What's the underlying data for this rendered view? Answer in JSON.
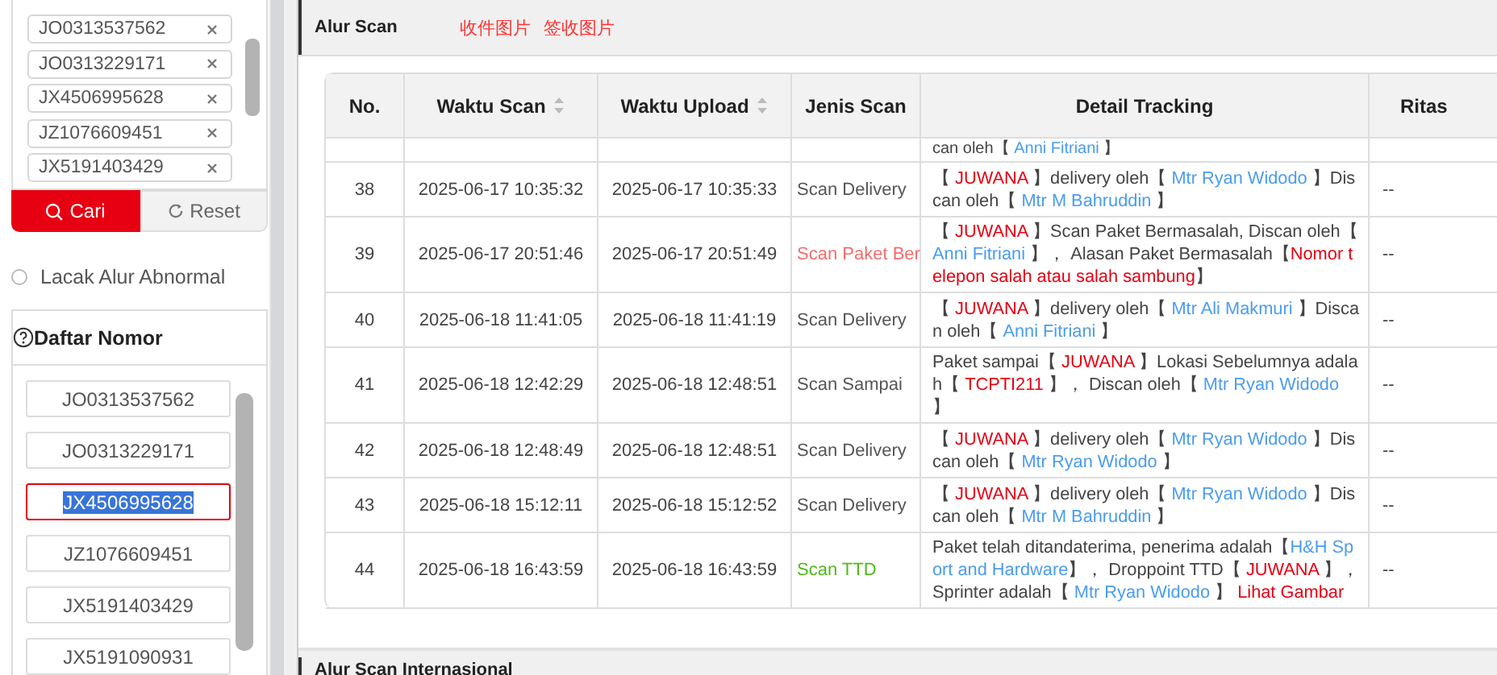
{
  "sidebar": {
    "tags": [
      {
        "label": "JO0313537562"
      },
      {
        "label": "JO0313229171"
      },
      {
        "label": "JX4506995628"
      },
      {
        "label": "JZ1076609451"
      },
      {
        "label": "JX5191403429"
      }
    ],
    "search_button": "Cari",
    "reset_button": "Reset",
    "abnormal_option": {
      "label": "Lacak Alur Abnormal",
      "checked": false
    },
    "number_list": {
      "title": "Daftar Nomor",
      "items": [
        {
          "label": "JO0313537562",
          "selected": false
        },
        {
          "label": "JO0313229171",
          "selected": false
        },
        {
          "label": "JX4506995628",
          "selected": true
        },
        {
          "label": "JZ1076609451",
          "selected": false
        },
        {
          "label": "JX5191403429",
          "selected": false
        },
        {
          "label": "JX5191090931",
          "selected": false
        }
      ]
    }
  },
  "section": {
    "title": "Alur Scan",
    "links": [
      "收件图片",
      "签收图片"
    ]
  },
  "table": {
    "columns": [
      {
        "label": "No.",
        "sortable": false
      },
      {
        "label": "Waktu Scan",
        "sortable": true
      },
      {
        "label": "Waktu Upload",
        "sortable": true
      },
      {
        "label": "Jenis Scan",
        "sortable": false
      },
      {
        "label": "Detail Tracking",
        "sortable": false
      },
      {
        "label": "Ritas",
        "sortable": false
      }
    ],
    "rows": [
      {
        "detail": [
          {
            "text": "can oleh【 ",
            "kind": "plain"
          },
          {
            "text": "Anni Fitriani",
            "kind": "person"
          },
          {
            "text": " 】",
            "kind": "plain"
          }
        ]
      },
      {
        "no": "38",
        "scan_time": "2025-06-17 10:35:32",
        "upload_time": "2025-06-17 10:35:33",
        "scan_type": {
          "text": "Scan Delivery",
          "kind": "normal"
        },
        "detail": [
          {
            "text": "【 ",
            "kind": "plain"
          },
          {
            "text": "JUWANA",
            "kind": "place"
          },
          {
            "text": " 】delivery oleh【 ",
            "kind": "plain"
          },
          {
            "text": "Mtr Ryan Widodo",
            "kind": "person"
          },
          {
            "text": " 】Discan oleh【 ",
            "kind": "plain"
          },
          {
            "text": "Mtr M Bahruddin",
            "kind": "person"
          },
          {
            "text": " 】",
            "kind": "plain"
          }
        ],
        "ritase": "--"
      },
      {
        "no": "39",
        "scan_time": "2025-06-17 20:51:46",
        "upload_time": "2025-06-17 20:51:49",
        "scan_type": {
          "text": "Scan Paket Ber",
          "kind": "problem"
        },
        "detail": [
          {
            "text": "【 ",
            "kind": "plain"
          },
          {
            "text": "JUWANA",
            "kind": "place"
          },
          {
            "text": " 】Scan Paket Bermasalah, Discan oleh【 ",
            "kind": "plain"
          },
          {
            "text": "Anni Fitriani",
            "kind": "person"
          },
          {
            "text": " 】， Alasan Paket Bermasalah【",
            "kind": "plain"
          },
          {
            "text": "Nomor telepon salah atau salah sambung",
            "kind": "alert"
          },
          {
            "text": "】",
            "kind": "plain"
          }
        ],
        "ritase": "--"
      },
      {
        "no": "40",
        "scan_time": "2025-06-18 11:41:05",
        "upload_time": "2025-06-18 11:41:19",
        "scan_type": {
          "text": "Scan Delivery",
          "kind": "normal"
        },
        "detail": [
          {
            "text": "【 ",
            "kind": "plain"
          },
          {
            "text": "JUWANA",
            "kind": "place"
          },
          {
            "text": " 】delivery oleh【 ",
            "kind": "plain"
          },
          {
            "text": "Mtr Ali Makmuri",
            "kind": "person"
          },
          {
            "text": " 】Discan oleh【 ",
            "kind": "plain"
          },
          {
            "text": "Anni Fitriani",
            "kind": "person"
          },
          {
            "text": " 】",
            "kind": "plain"
          }
        ],
        "ritase": "--"
      },
      {
        "no": "41",
        "scan_time": "2025-06-18 12:42:29",
        "upload_time": "2025-06-18 12:48:51",
        "scan_type": {
          "text": "Scan Sampai",
          "kind": "normal"
        },
        "detail": [
          {
            "text": "Paket sampai【 ",
            "kind": "plain"
          },
          {
            "text": "JUWANA",
            "kind": "place"
          },
          {
            "text": " 】Lokasi Sebelumnya adalah【 ",
            "kind": "plain"
          },
          {
            "text": "TCPTI211",
            "kind": "place"
          },
          {
            "text": " 】， Discan oleh【 ",
            "kind": "plain"
          },
          {
            "text": "Mtr Ryan Widodo",
            "kind": "person"
          },
          {
            "text": " 】",
            "kind": "plain"
          }
        ],
        "ritase": "--"
      },
      {
        "no": "42",
        "scan_time": "2025-06-18 12:48:49",
        "upload_time": "2025-06-18 12:48:51",
        "scan_type": {
          "text": "Scan Delivery",
          "kind": "normal"
        },
        "detail": [
          {
            "text": "【 ",
            "kind": "plain"
          },
          {
            "text": "JUWANA",
            "kind": "place"
          },
          {
            "text": " 】delivery oleh【 ",
            "kind": "plain"
          },
          {
            "text": "Mtr Ryan Widodo",
            "kind": "person"
          },
          {
            "text": " 】Discan oleh【 ",
            "kind": "plain"
          },
          {
            "text": "Mtr Ryan Widodo",
            "kind": "person"
          },
          {
            "text": " 】",
            "kind": "plain"
          }
        ],
        "ritase": "--"
      },
      {
        "no": "43",
        "scan_time": "2025-06-18 15:12:11",
        "upload_time": "2025-06-18 15:12:52",
        "scan_type": {
          "text": "Scan Delivery",
          "kind": "normal"
        },
        "detail": [
          {
            "text": "【 ",
            "kind": "plain"
          },
          {
            "text": "JUWANA",
            "kind": "place"
          },
          {
            "text": " 】delivery oleh【 ",
            "kind": "plain"
          },
          {
            "text": "Mtr Ryan Widodo",
            "kind": "person"
          },
          {
            "text": " 】Discan oleh【 ",
            "kind": "plain"
          },
          {
            "text": "Mtr M Bahruddin",
            "kind": "person"
          },
          {
            "text": " 】",
            "kind": "plain"
          }
        ],
        "ritase": "--"
      },
      {
        "no": "44",
        "scan_time": "2025-06-18 16:43:59",
        "upload_time": "2025-06-18 16:43:59",
        "scan_type": {
          "text": "Scan TTD",
          "kind": "signed"
        },
        "detail": [
          {
            "text": "Paket telah ditandaterima, penerima adalah【",
            "kind": "plain"
          },
          {
            "text": "H&H Sport and Hardware",
            "kind": "person"
          },
          {
            "text": "】， Droppoint TTD【 ",
            "kind": "plain"
          },
          {
            "text": "JUWANA",
            "kind": "place"
          },
          {
            "text": " 】， Sprinter adalah【 ",
            "kind": "plain"
          },
          {
            "text": "Mtr Ryan Widodo",
            "kind": "person"
          },
          {
            "text": " 】 ",
            "kind": "plain"
          },
          {
            "text": "Lihat Gambar",
            "kind": "link"
          }
        ],
        "ritase": "--"
      }
    ]
  },
  "next_section": {
    "title": "Alur Scan Internasional"
  }
}
